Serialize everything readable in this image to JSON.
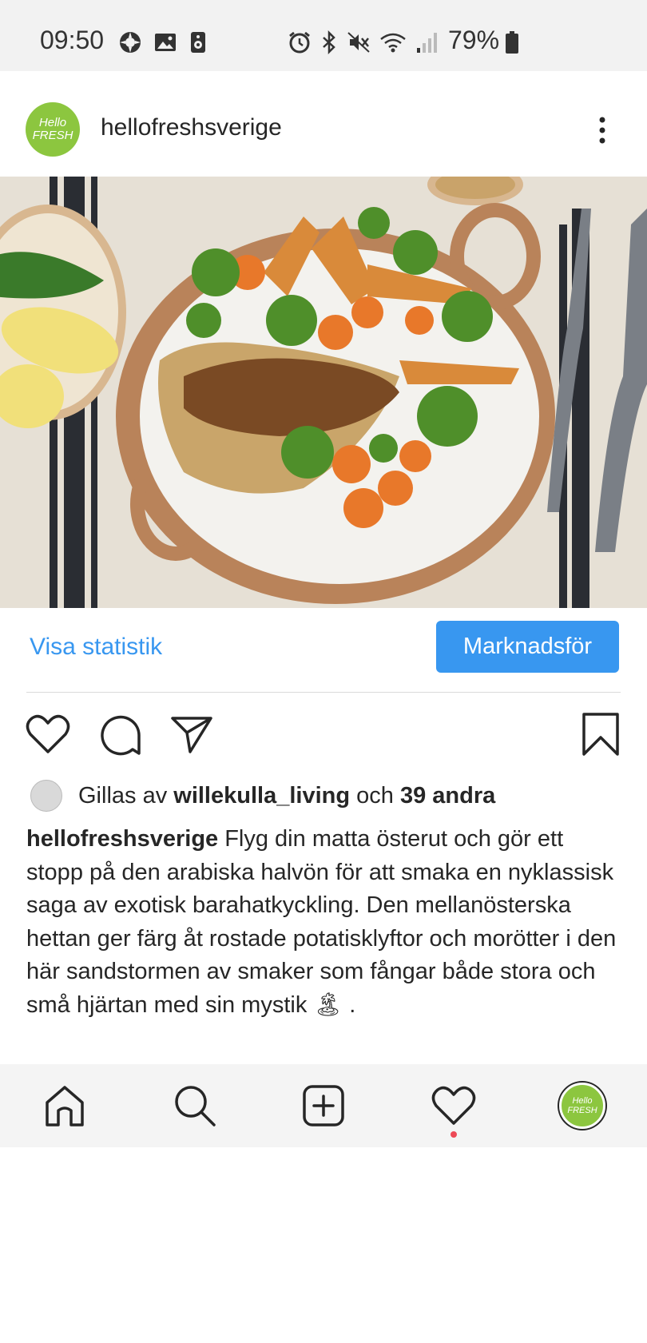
{
  "status_bar": {
    "time": "09:50",
    "battery_percent": "79%",
    "left_icons": [
      "sync-icon",
      "image-icon",
      "speaker-icon"
    ],
    "right_icons": [
      "alarm-icon",
      "bluetooth-icon",
      "mute-icon",
      "wifi-icon",
      "signal-icon",
      "battery-icon"
    ]
  },
  "post": {
    "username": "hellofreshsverige",
    "avatar_text": [
      "Hello",
      "FRESH"
    ],
    "photo_alt": "Plate of chicken with broccoli, carrots and potato wedges",
    "stats_link": "Visa statistik",
    "promote_button": "Marknadsför",
    "likes": {
      "prefix": "Gillas av ",
      "user": "willekulla_living",
      "middle": " och ",
      "others": "39 andra"
    },
    "caption": {
      "author": "hellofreshsverige",
      "text": " Flyg din matta österut och gör ett stopp på den arabiska halvön för att smaka en nyklassisk saga av exotisk barahatkyckling. Den mellanösterska hettan ger färg åt rostade potatisklyftor och morötter i den här sandstormen av smaker som fångar både stora och små hjärtan med sin mystik 🏝 ."
    }
  },
  "bottom_nav": {
    "items": [
      "home-icon",
      "search-icon",
      "add-post-icon",
      "activity-icon",
      "profile-avatar"
    ]
  },
  "colors": {
    "accent": "#3897f0",
    "brand_green": "#8cc63f",
    "notification_red": "#ed4956"
  }
}
